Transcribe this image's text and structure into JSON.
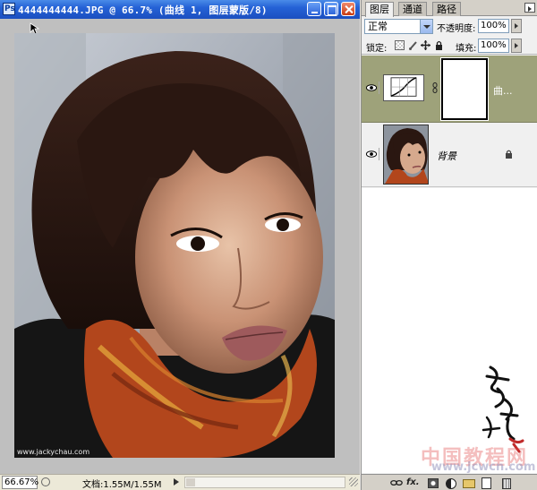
{
  "document_window": {
    "title": "4444444444.JPG @ 66.7% (曲线 1, 图层蒙版/8)",
    "app_icon_text": "Ps",
    "controls": {
      "minimize": "minimize-icon",
      "maximize": "maximize-icon",
      "close": "close-icon"
    }
  },
  "canvas": {
    "background_color": "#bfbfbf",
    "photo_watermark": "www.jackychau.com"
  },
  "status_bar": {
    "zoom": "66.67%",
    "doc_size": "文档:1.55M/1.55M"
  },
  "layers_panel": {
    "tabs": [
      {
        "label": "图层",
        "active": true
      },
      {
        "label": "通道",
        "active": false
      },
      {
        "label": "路径",
        "active": false
      }
    ],
    "blend_mode": "正常",
    "opacity_label": "不透明度:",
    "opacity_value": "100%",
    "lock_label": "锁定:",
    "fill_label": "填充:",
    "fill_value": "100%",
    "layers": [
      {
        "name": "曲...",
        "type": "curves-adjustment",
        "selected": true,
        "visible": true
      },
      {
        "name": "背景",
        "type": "background",
        "selected": false,
        "visible": true,
        "locked": true
      }
    ],
    "selected_layer_color": "#9ea27a",
    "bottom_buttons": [
      "link-layers-icon",
      "fx-icon",
      "add-mask-icon",
      "adjustment-layer-icon",
      "group-folder-icon",
      "new-layer-icon",
      "trash-icon"
    ],
    "fx_label": "fx."
  },
  "watermark": {
    "logo_text": "中国教程网",
    "site_text": "www.jcwcn.com"
  }
}
